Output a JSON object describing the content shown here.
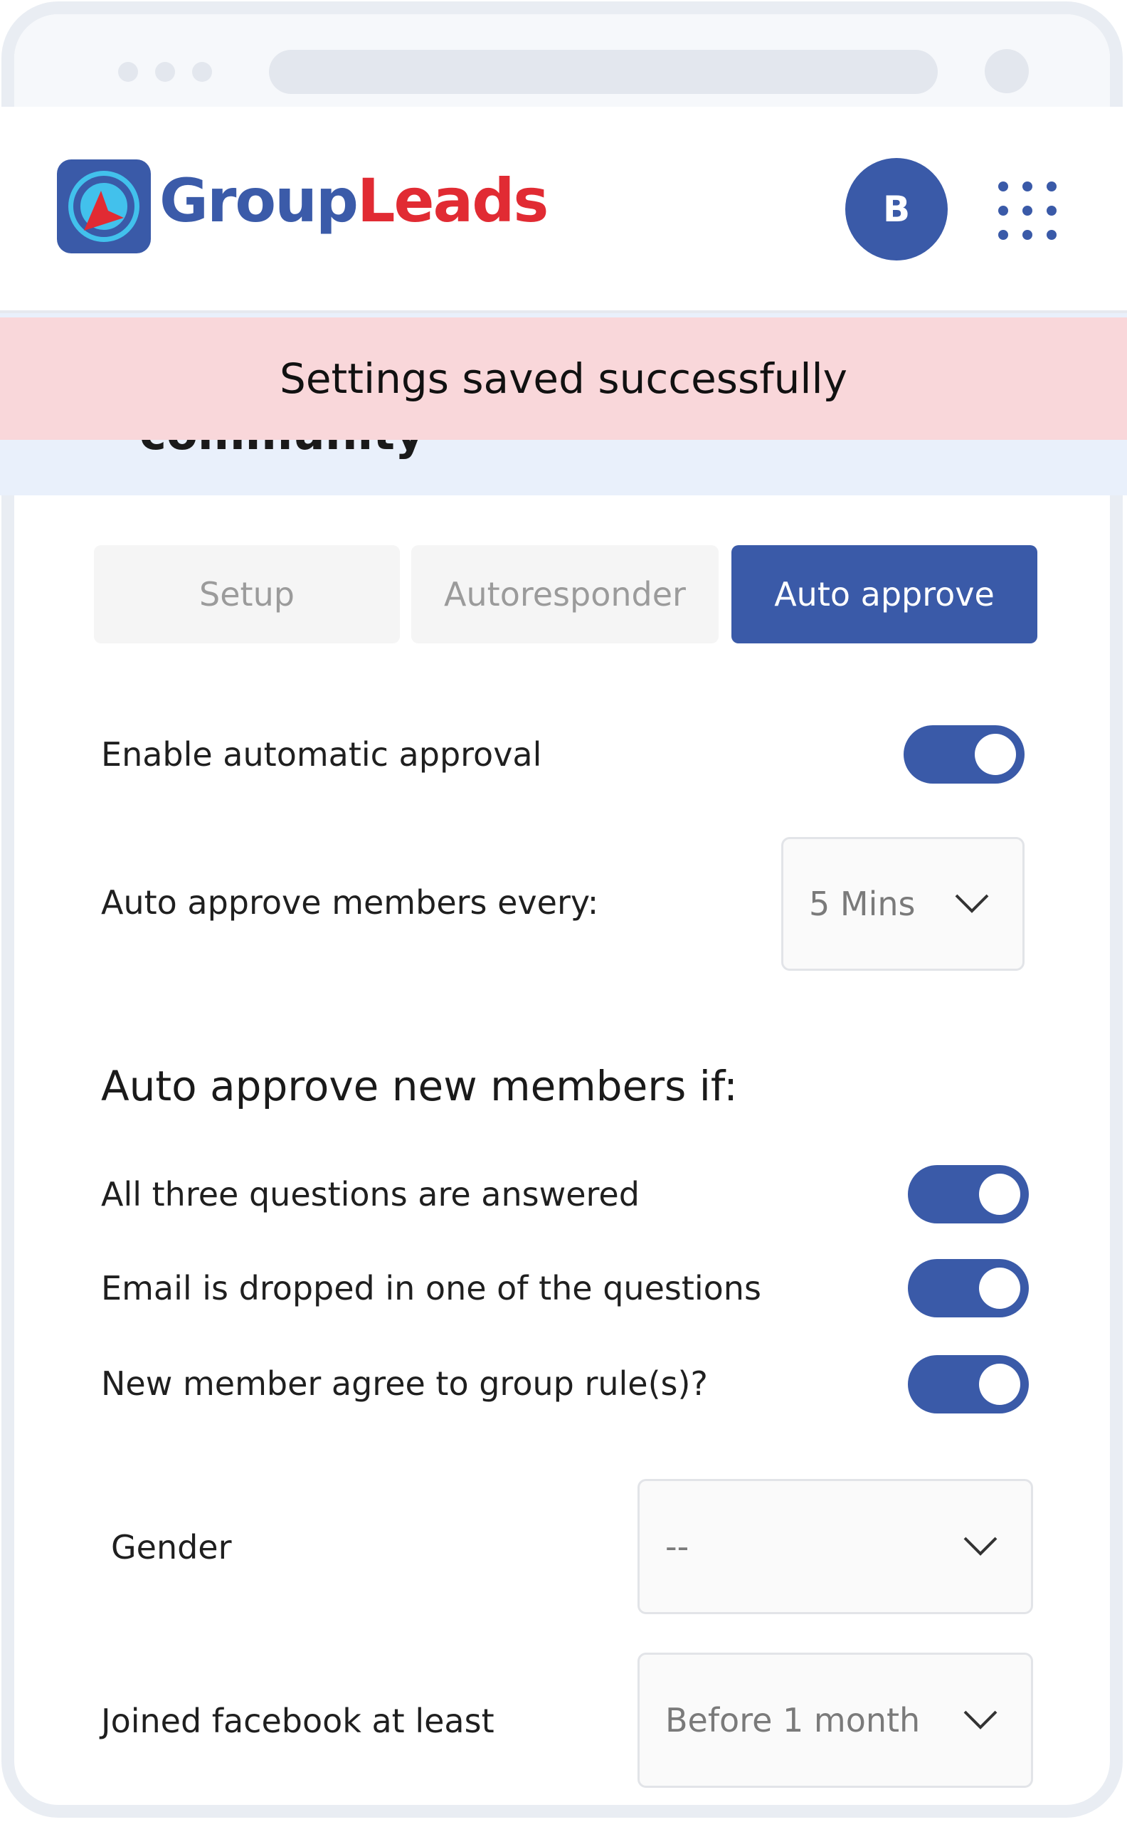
{
  "app": {
    "brand_part1": "Group",
    "brand_part2": "Leads",
    "avatar_initial": "B"
  },
  "toast": {
    "message": "Settings saved successfully"
  },
  "community": {
    "title_fragment": "community"
  },
  "tabs": [
    {
      "label": "Setup",
      "active": false
    },
    {
      "label": "Autoresponder",
      "active": false
    },
    {
      "label": "Auto approve",
      "active": true
    }
  ],
  "settings": {
    "enable_label": "Enable automatic approval",
    "enable_value": true,
    "interval_label": "Auto approve members every:",
    "interval_value": "5 Mins"
  },
  "conditions": {
    "heading": "Auto approve new members if:",
    "items": [
      {
        "label": "All three questions are answered",
        "enabled": true
      },
      {
        "label": "Email is dropped in one of the questions",
        "enabled": true
      },
      {
        "label": "New member agree to group rule(s)?",
        "enabled": true
      }
    ]
  },
  "filters": {
    "gender_label": "Gender",
    "gender_value": "--",
    "joined_label": "Joined facebook at least",
    "joined_value": "Before 1 month"
  },
  "colors": {
    "accent": "#3a5aa8",
    "brand_red": "#e12b33",
    "toast_bg": "#f9d7da"
  },
  "icons": [
    "logo-icon",
    "apps-grid-icon",
    "chevron-down-icon"
  ]
}
